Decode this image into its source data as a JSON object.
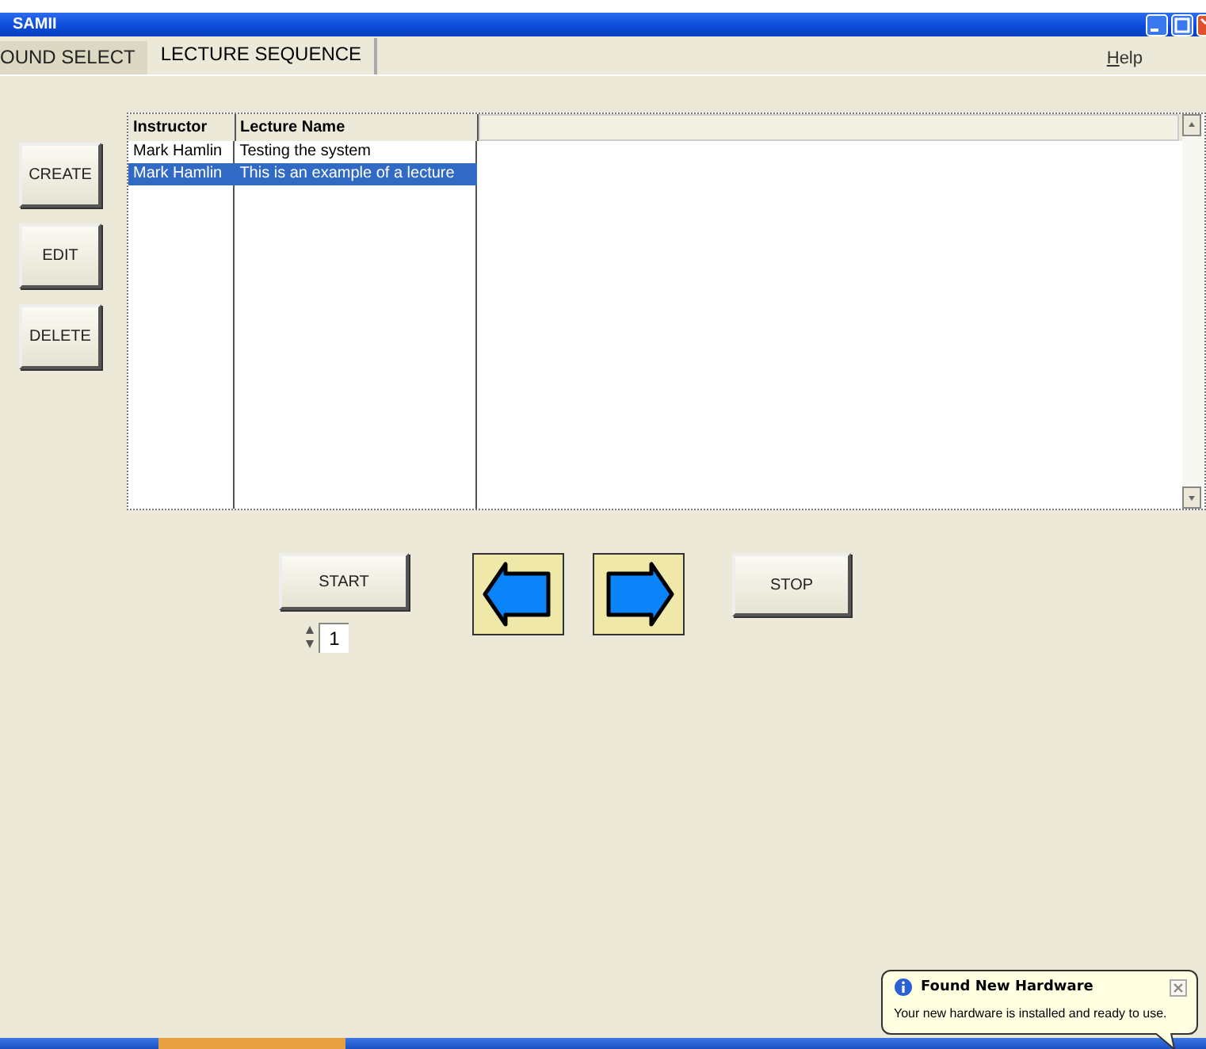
{
  "window": {
    "title": "SAMII"
  },
  "tabs": [
    {
      "label": "OUND SELECT",
      "selected": false
    },
    {
      "label": "LECTURE SEQUENCE",
      "selected": true
    }
  ],
  "menu": [
    {
      "label": "Help"
    }
  ],
  "side_buttons": [
    "CREATE",
    "EDIT",
    "DELETE"
  ],
  "table": {
    "columns": [
      "Instructor",
      "Lecture Name"
    ],
    "rows": [
      {
        "cells": [
          "Mark Hamlin",
          "Testing the system"
        ],
        "selected": false
      },
      {
        "cells": [
          "Mark Hamlin",
          "This is an example of a lecture"
        ],
        "selected": true
      }
    ]
  },
  "start_button": "START",
  "counter": {
    "value": "1"
  },
  "stop_button": "STOP",
  "notification": {
    "title": "Found New Hardware",
    "message": "Your new hardware is installed and ready to use."
  }
}
